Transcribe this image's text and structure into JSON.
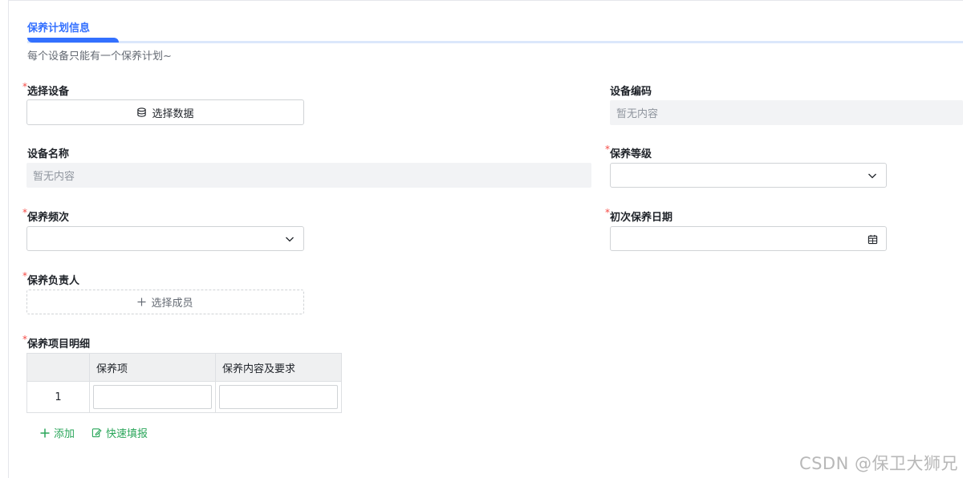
{
  "section": {
    "title": "保养计划信息",
    "hint": "每个设备只能有一个保养计划~"
  },
  "fields": {
    "select_device": {
      "label": "选择设备",
      "required": "*",
      "button": "选择数据"
    },
    "device_code": {
      "label": "设备编码",
      "value": "暂无内容"
    },
    "device_name": {
      "label": "设备名称",
      "value": "暂无内容"
    },
    "maintain_level": {
      "label": "保养等级",
      "required": "*"
    },
    "maintain_frequency": {
      "label": "保养频次",
      "required": "*"
    },
    "first_date": {
      "label": "初次保养日期",
      "required": "*"
    },
    "owner": {
      "label": "保养负责人",
      "required": "*",
      "button": "选择成员"
    },
    "items": {
      "label": "保养项目明细",
      "required": "*"
    }
  },
  "table": {
    "columns": [
      "",
      "保养项",
      "保养内容及要求"
    ],
    "rows": [
      {
        "index": "1"
      }
    ]
  },
  "actions": {
    "add": "添加",
    "quick_fill": "快速填报"
  },
  "watermark": "CSDN @保卫大狮兄",
  "colors": {
    "accent": "#3370ff",
    "required": "#f54a45",
    "action": "#2aa65a"
  }
}
